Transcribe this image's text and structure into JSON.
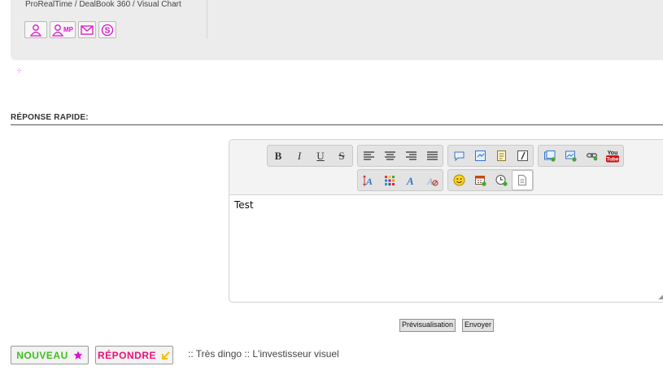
{
  "profile": {
    "broker_text": "ProRealTime / DealBook 360 / Visual Chart",
    "contact_icons": [
      {
        "name": "profile-icon",
        "label": ""
      },
      {
        "name": "private-message-icon",
        "label": "MP"
      },
      {
        "name": "email-icon",
        "label": ""
      },
      {
        "name": "skype-icon",
        "label": ""
      }
    ]
  },
  "quick_reply": {
    "title": "RÉPONSE RAPIDE:",
    "editor_text": "Test",
    "preview_label": "Prévisualisation",
    "send_label": "Envoyer"
  },
  "toolbar": {
    "bold": "B",
    "italic": "I",
    "underline": "U",
    "strike": "S",
    "youtube_top": "You",
    "youtube_bottom": "Tube"
  },
  "actions": {
    "new_label": "NOUVEAU",
    "reply_label": "RÉPONDRE"
  },
  "breadcrumb": {
    "text": ":: Très dingo :: L'investisseur visuel"
  },
  "colors": {
    "accent_pink": "#e010d0",
    "new_green": "#3ec01c",
    "reply_pink": "#ee1077"
  }
}
